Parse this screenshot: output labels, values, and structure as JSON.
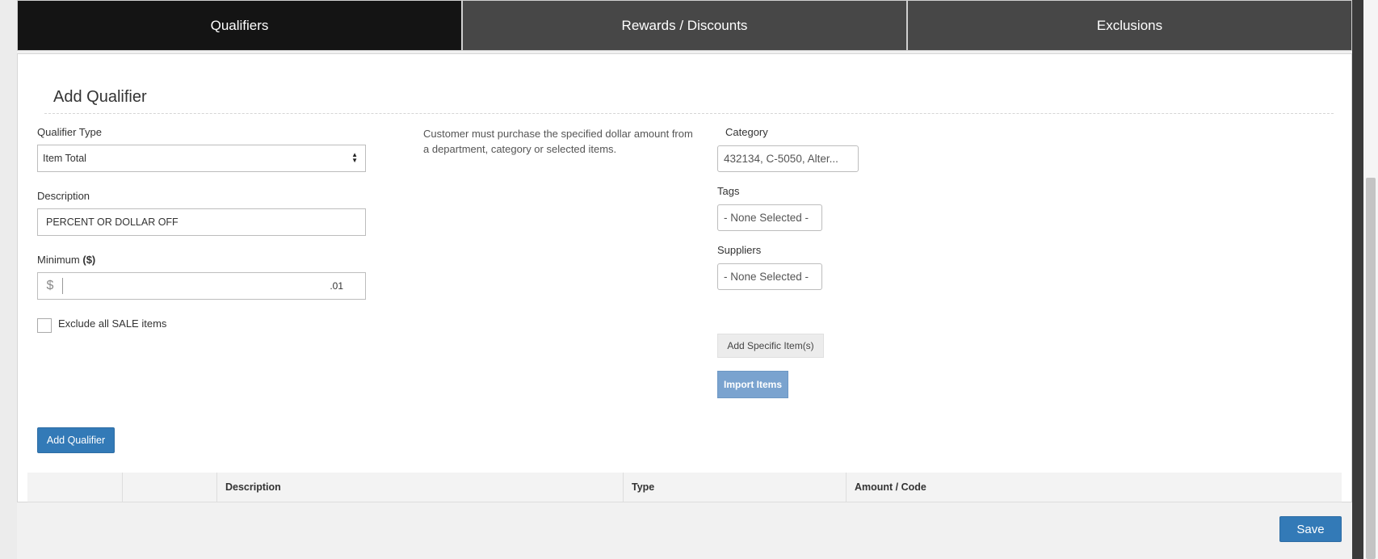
{
  "tabs": [
    {
      "label": "Qualifiers",
      "active": true
    },
    {
      "label": "Rewards / Discounts",
      "active": false
    },
    {
      "label": "Exclusions",
      "active": false
    }
  ],
  "section": {
    "title": "Add Qualifier"
  },
  "form": {
    "qualifier_type": {
      "label": "Qualifier Type",
      "value": "Item Total"
    },
    "description": {
      "label": "Description",
      "value": "PERCENT OR DOLLAR OFF"
    },
    "minimum": {
      "label": "Minimum",
      "unit": "($)",
      "currency_symbol": "$",
      "value": "",
      "suffix": ".01"
    },
    "exclude_sale": {
      "label": "Exclude all SALE items",
      "checked": false
    }
  },
  "help_text": "Customer must purchase the specified dollar amount from a department, category or selected items.",
  "filters": {
    "category": {
      "label": "Category",
      "value": "432134, C-5050, Alter..."
    },
    "tags": {
      "label": "Tags",
      "value": "- None Selected -"
    },
    "suppliers": {
      "label": "Suppliers",
      "value": "- None Selected -"
    }
  },
  "buttons": {
    "add_specific": "Add Specific Item(s)",
    "import_items": "Import Items",
    "add_qualifier": "Add Qualifier",
    "save": "Save"
  },
  "table": {
    "columns": [
      "",
      "",
      "Description",
      "Type",
      "Amount / Code"
    ]
  },
  "colors": {
    "active_tab": "#141414",
    "inactive_tab": "#474747",
    "primary": "#337ab7",
    "primary_light": "#7aa3cf"
  }
}
